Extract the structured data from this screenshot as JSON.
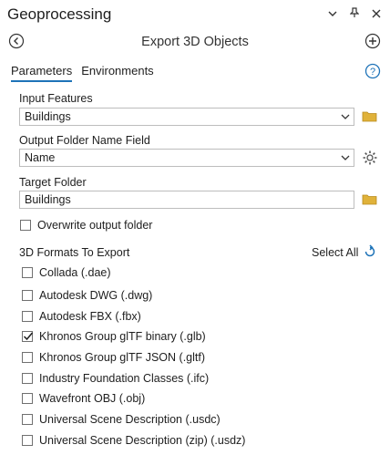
{
  "window": {
    "title": "Geoprocessing"
  },
  "tool": {
    "title": "Export 3D Objects"
  },
  "tabs": [
    {
      "label": "Parameters",
      "active": true
    },
    {
      "label": "Environments",
      "active": false
    }
  ],
  "params": {
    "input_features": {
      "label": "Input Features",
      "value": "Buildings"
    },
    "output_folder_name_field": {
      "label": "Output Folder Name Field",
      "value": "Name"
    },
    "target_folder": {
      "label": "Target Folder",
      "value": "Buildings"
    },
    "overwrite": {
      "label": "Overwrite output folder",
      "checked": false
    }
  },
  "formats": {
    "label": "3D Formats To Export",
    "select_all_label": "Select All",
    "items": [
      {
        "label": "Collada (.dae)",
        "checked": false
      },
      {
        "label": "Autodesk DWG (.dwg)",
        "checked": false
      },
      {
        "label": "Autodesk FBX (.fbx)",
        "checked": false
      },
      {
        "label": "Khronos Group glTF binary (.glb)",
        "checked": true
      },
      {
        "label": "Khronos Group glTF JSON (.gltf)",
        "checked": false
      },
      {
        "label": "Industry Foundation Classes (.ifc)",
        "checked": false
      },
      {
        "label": "Wavefront OBJ (.obj)",
        "checked": false
      },
      {
        "label": "Universal Scene Description (.usdc)",
        "checked": false
      },
      {
        "label": "Universal Scene Description (zip) (.usdz)",
        "checked": false
      }
    ]
  },
  "colors": {
    "accent": "#1e73b8",
    "folder": "#e0b23a"
  }
}
